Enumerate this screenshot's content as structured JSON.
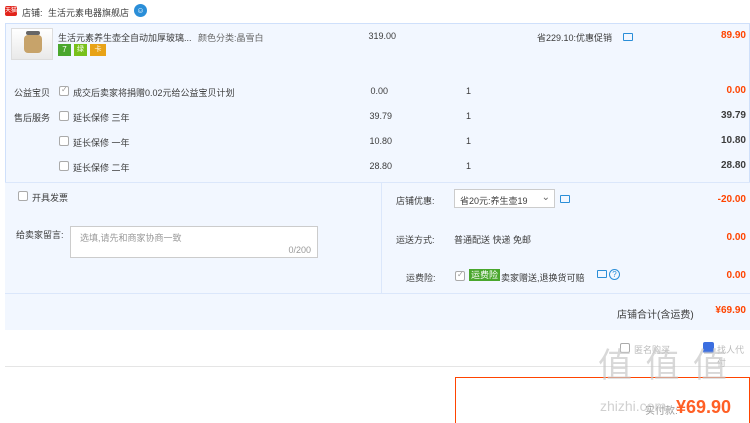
{
  "shop": {
    "label": "店铺:",
    "name": "生活元素电器旗舰店",
    "badge": "天猫"
  },
  "product": {
    "title": "生活元素养生壶全自动加厚玻璃...",
    "spec": "颜色分类:晶雪白",
    "price": "319.00",
    "promo": "省229.10:优惠促销",
    "subtotal": "89.90",
    "badges": [
      "7",
      "绿",
      "卡"
    ]
  },
  "charity": {
    "section": "公益宝贝",
    "text": "成交后卖家将捐赠0.02元给公益宝贝计划",
    "price": "0.00",
    "qty": "1",
    "subtotal": "0.00"
  },
  "service": {
    "section": "售后服务",
    "items": [
      {
        "label": "延长保修 三年",
        "price": "39.79",
        "qty": "1",
        "subtotal": "39.79"
      },
      {
        "label": "延长保修 一年",
        "price": "10.80",
        "qty": "1",
        "subtotal": "10.80"
      },
      {
        "label": "延长保修 二年",
        "price": "28.80",
        "qty": "1",
        "subtotal": "28.80"
      }
    ]
  },
  "invoice": {
    "label": "开具发票"
  },
  "message": {
    "label": "给卖家留言:",
    "placeholder": "选填,请先和商家协商一致",
    "counter": "0/200"
  },
  "discount": {
    "label": "店铺优惠:",
    "selected": "省20元:养生壶19",
    "amount": "-20.00"
  },
  "shipping": {
    "label": "运送方式:",
    "value": "普通配送 快递 免邮",
    "amount": "0.00"
  },
  "insurance": {
    "label": "运费险:",
    "tag": "运费险",
    "text": "卖家赠送,退换货可赔",
    "amount": "0.00"
  },
  "shop_total": {
    "label": "店铺合计(含运费)",
    "value": "¥69.90"
  },
  "footer": {
    "partial_left": "匿名购买",
    "partial_right": "找人代付",
    "pay_label": "实付款:",
    "pay_value": "¥69.90",
    "watermark": "值 值 值",
    "watermark_url": "zhizhi.com"
  },
  "colors": {
    "accent": "#f40",
    "panel_bg": "#f2f7ff",
    "border": "#b2d1ff"
  }
}
